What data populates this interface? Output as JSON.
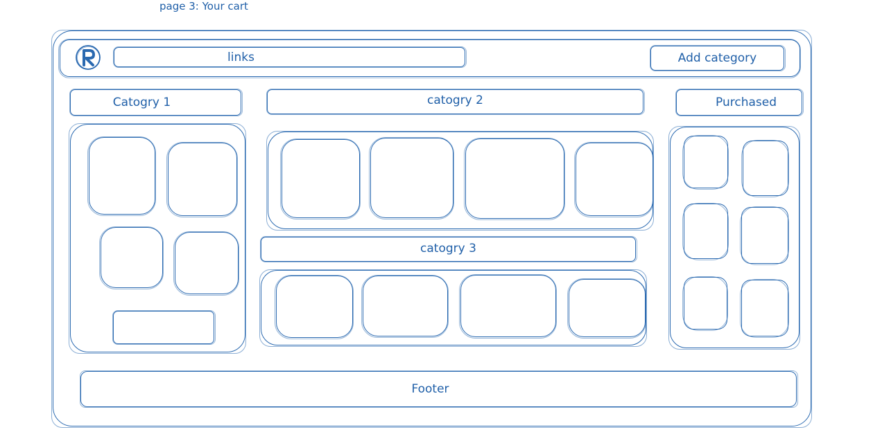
{
  "caption": "page 3: Your cart",
  "header": {
    "links_label": "links",
    "add_category_label": "Add category"
  },
  "sections": {
    "category_1": "Catogry 1",
    "category_2": "catogry 2",
    "category_3": "catogry 3",
    "purchased": "Purchased"
  },
  "footer": {
    "label": "Footer"
  },
  "colors": {
    "stroke": "#2a69b0",
    "text": "#1f5fa8"
  },
  "icons": {
    "logo": "r-logo-icon"
  }
}
